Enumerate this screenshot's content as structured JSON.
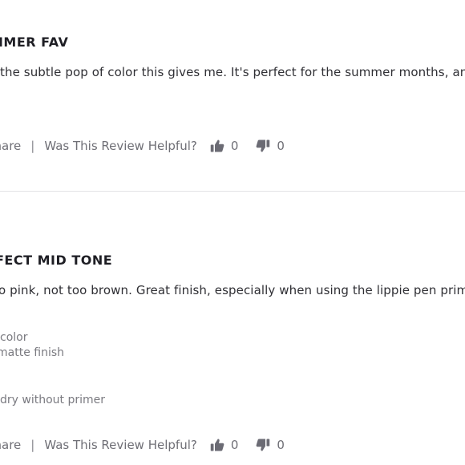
{
  "reviews": [
    {
      "title": "MMER FAV",
      "body": "the subtle pop of color this gives me. It's perfect for the summer months, and loo",
      "details": [],
      "share_label": "Share",
      "separator": "|",
      "helpful_label": "Was This Review Helpful?",
      "upvotes": "0",
      "downvotes": "0"
    },
    {
      "title": "FECT MID TONE",
      "body": "o pink, not too brown. Great finish, especially when using the lippie pen primer f",
      "details": [
        "color",
        "matte finish",
        "dry without primer"
      ],
      "share_label": "Share",
      "separator": "|",
      "helpful_label": "Was This Review Helpful?",
      "upvotes": "0",
      "downvotes": "0"
    }
  ],
  "icons": {
    "upvote": "thumbs-up-icon",
    "downvote": "thumbs-down-icon"
  },
  "colors": {
    "icon": "#6b6b74",
    "text": "#2f2f34",
    "muted": "#7a7a80",
    "divider": "#e3e3e6"
  }
}
